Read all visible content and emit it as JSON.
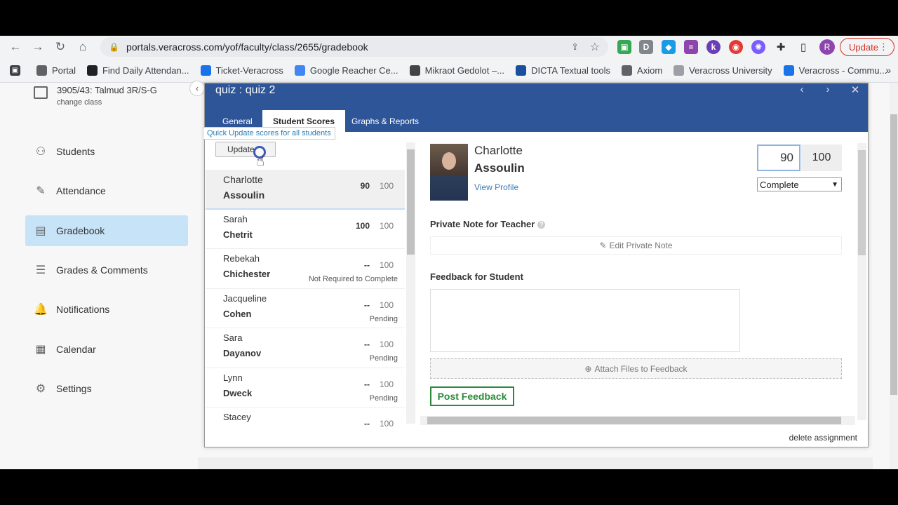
{
  "browser": {
    "url": "portals.veracross.com/yof/faculty/class/2655/gradebook",
    "update_label": "Update",
    "profile_initial": "R",
    "bookmarks": [
      {
        "label": "Portal",
        "icon": "portal-icon",
        "color": "#5f6368"
      },
      {
        "label": "Find Daily Attendan...",
        "icon": "github-icon",
        "color": "#202124"
      },
      {
        "label": "Ticket-Veracross",
        "icon": "cloud-icon",
        "color": "#1a73e8"
      },
      {
        "label": "Google Reacher Ce...",
        "icon": "google-icon",
        "color": "#4285f4"
      },
      {
        "label": "Mikraot Gedolot –...",
        "icon": "book-icon",
        "color": "#444444"
      },
      {
        "label": "DICTA Textual tools",
        "icon": "dicta-icon",
        "color": "#1a4fa0"
      },
      {
        "label": "Axiom",
        "icon": "globe-icon",
        "color": "#5f6368"
      },
      {
        "label": "Veracross University",
        "icon": "veracross-icon",
        "color": "#9aa0a6"
      },
      {
        "label": "Veracross - Commu...",
        "icon": "cloud-icon",
        "color": "#1a73e8"
      }
    ]
  },
  "sidebar": {
    "class_name": "3905/43: Talmud 3R/S-G",
    "change_class": "change class",
    "items": [
      {
        "label": "Students",
        "icon": "students-icon",
        "active": false
      },
      {
        "label": "Attendance",
        "icon": "pencil-icon",
        "active": false
      },
      {
        "label": "Gradebook",
        "icon": "gradebook-icon",
        "active": true
      },
      {
        "label": "Grades & Comments",
        "icon": "comments-icon",
        "active": false
      },
      {
        "label": "Notifications",
        "icon": "bell-icon",
        "active": false
      },
      {
        "label": "Calendar",
        "icon": "calendar-icon",
        "active": false
      },
      {
        "label": "Settings",
        "icon": "gear-icon",
        "active": false
      }
    ]
  },
  "modal": {
    "title": "quiz : quiz 2",
    "tabs": [
      "General",
      "Student Scores",
      "Graphs & Reports"
    ],
    "active_tab": "Student Scores",
    "tooltip": "Quick Update scores for all students",
    "update_button": "Update",
    "delete_label": "delete assignment",
    "students": [
      {
        "first": "Charlotte",
        "last": "Assoulin",
        "score": "90",
        "max": "100",
        "status": ""
      },
      {
        "first": "Sarah",
        "last": "Chetrit",
        "score": "100",
        "max": "100",
        "status": ""
      },
      {
        "first": "Rebekah",
        "last": "Chichester",
        "score": "--",
        "max": "100",
        "status": "Not Required to Complete"
      },
      {
        "first": "Jacqueline",
        "last": "Cohen",
        "score": "--",
        "max": "100",
        "status": "Pending"
      },
      {
        "first": "Sara",
        "last": "Dayanov",
        "score": "--",
        "max": "100",
        "status": "Pending"
      },
      {
        "first": "Lynn",
        "last": "Dweck",
        "score": "--",
        "max": "100",
        "status": "Pending"
      },
      {
        "first": "Stacey",
        "last": "",
        "score": "--",
        "max": "100",
        "status": ""
      }
    ],
    "detail": {
      "first": "Charlotte",
      "last": "Assoulin",
      "view_profile": "View Profile",
      "score_value": "90",
      "score_max": "100",
      "status_value": "Complete",
      "private_note_label": "Private Note for Teacher",
      "edit_private_note": "Edit Private Note",
      "feedback_label": "Feedback for Student",
      "attach_label": "Attach Files to Feedback",
      "post_button": "Post Feedback"
    }
  }
}
